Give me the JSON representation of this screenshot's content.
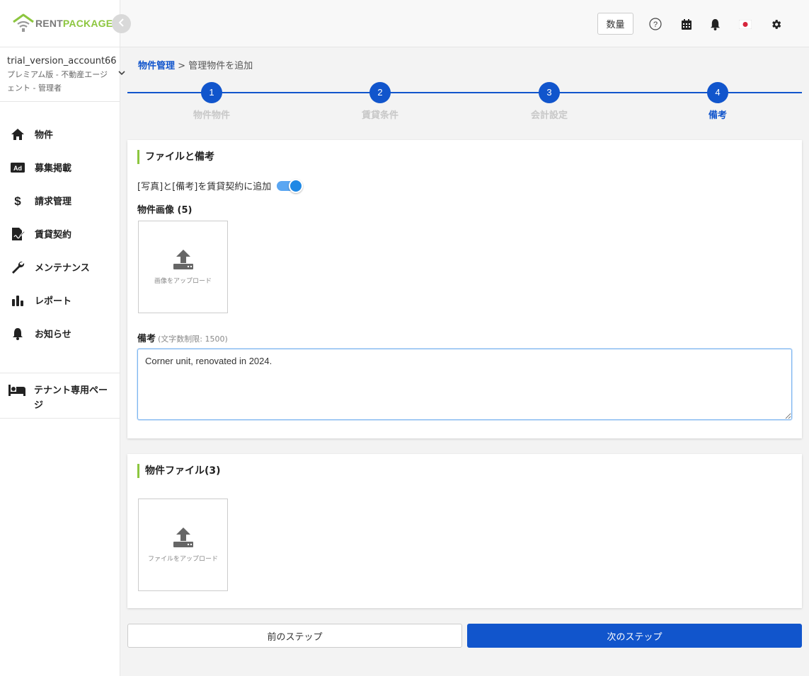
{
  "app": {
    "logo_part1": "RENT",
    "logo_part2": "PACKAGE",
    "brand_green": "#8cc63f",
    "accent_blue": "#1155cc"
  },
  "account": {
    "name": "trial_version_account66",
    "role": "プレミアム版 - 不動産エージェント - 管理者"
  },
  "sidebar": {
    "items": [
      {
        "label": "物件",
        "icon": "home-icon"
      },
      {
        "label": "募集掲載",
        "icon": "ad-icon"
      },
      {
        "label": "請求管理",
        "icon": "dollar-icon"
      },
      {
        "label": "賃貸契約",
        "icon": "contract-icon"
      },
      {
        "label": "メンテナンス",
        "icon": "wrench-icon"
      },
      {
        "label": "レポート",
        "icon": "bar-chart-icon"
      },
      {
        "label": "お知らせ",
        "icon": "bell-icon"
      }
    ],
    "tenant_label": "テナント専用ページ"
  },
  "header": {
    "qty_label": "数量"
  },
  "breadcrumb": {
    "parent": "物件管理",
    "separator": ">",
    "current": "管理物件を追加"
  },
  "stepper": {
    "steps": [
      {
        "number": "1",
        "label": "物件物件"
      },
      {
        "number": "2",
        "label": "賃貸条件"
      },
      {
        "number": "3",
        "label": "会計設定"
      },
      {
        "number": "4",
        "label": "備考"
      }
    ],
    "active_step": 4
  },
  "files_notes": {
    "title": "ファイルと備考",
    "toggle_label": "[写真]と[備考]を賃貸契約に追加",
    "toggle_on": true,
    "images_label": "物件画像 (5)",
    "image_upload_text": "画像をアップロード",
    "memo_label": "備考",
    "memo_hint": "(文字数制限: 1500)",
    "memo_value": "Corner unit, renovated in 2024."
  },
  "property_files": {
    "title": "物件ファイル(3)",
    "file_upload_text": "ファイルをアップロード"
  },
  "footer": {
    "prev_label": "前のステップ",
    "next_label": "次のステップ"
  }
}
